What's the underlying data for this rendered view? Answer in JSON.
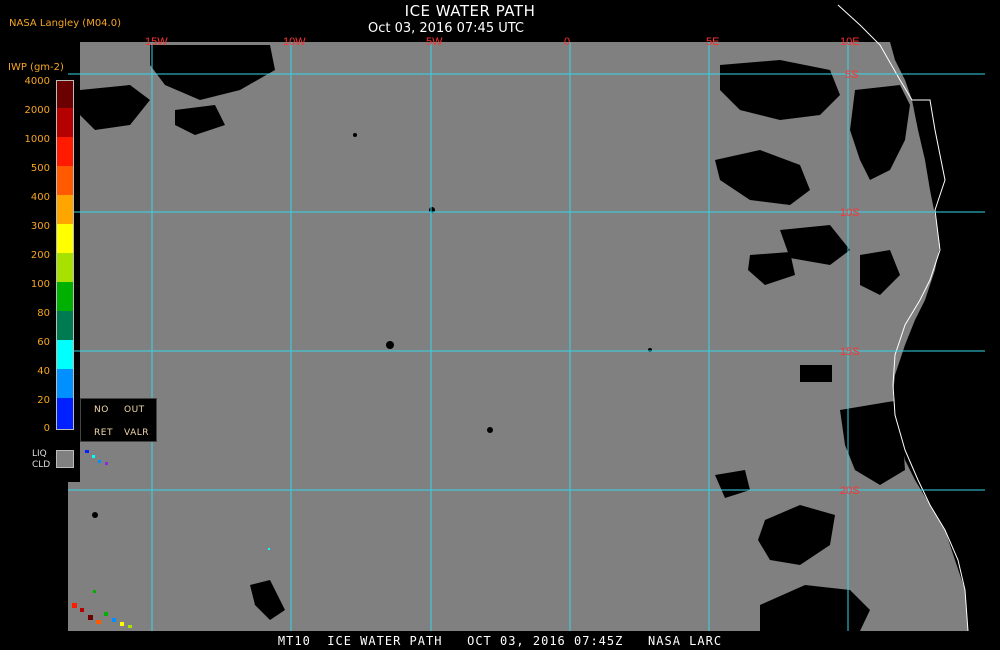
{
  "header": {
    "title": "ICE WATER PATH",
    "subtitle": "Oct 03, 2016 07:45 UTC",
    "agency": "NASA Langley (M04.0)"
  },
  "legend": {
    "unit": "IWP (gm-2)",
    "levels": [
      {
        "label": "4000",
        "color": "#6b0000"
      },
      {
        "label": "2000",
        "color": "#b50000"
      },
      {
        "label": "1000",
        "color": "#ff1a00"
      },
      {
        "label": "500",
        "color": "#ff5a00"
      },
      {
        "label": "400",
        "color": "#ffa500"
      },
      {
        "label": "300",
        "color": "#ffff00"
      },
      {
        "label": "200",
        "color": "#a8e000"
      },
      {
        "label": "100",
        "color": "#00b000"
      },
      {
        "label": "80",
        "color": "#007a50"
      },
      {
        "label": "60",
        "color": "#00ffff"
      },
      {
        "label": "40",
        "color": "#0090ff"
      },
      {
        "label": "20",
        "color": "#0020ff"
      },
      {
        "label": "0",
        "color": "#8a2be2"
      }
    ],
    "nodata": {
      "no": "NO",
      "out": "OUT",
      "ret": "RET",
      "valr": "VALR"
    },
    "liq_line1": "LIQ",
    "liq_line2": "CLD",
    "liq_color": "#808080"
  },
  "map": {
    "background_color": "#808080",
    "grid_color": "#33d6e6",
    "label_color": "#ff3333",
    "lon_labels": [
      "15W",
      "10W",
      "5W",
      "0",
      "5E",
      "10E"
    ],
    "lat_labels": [
      "5S",
      "10S",
      "15S",
      "20S"
    ]
  },
  "footer": {
    "text": "MT10  ICE WATER PATH   OCT 03, 2016 07:45Z   NASA LARC"
  }
}
